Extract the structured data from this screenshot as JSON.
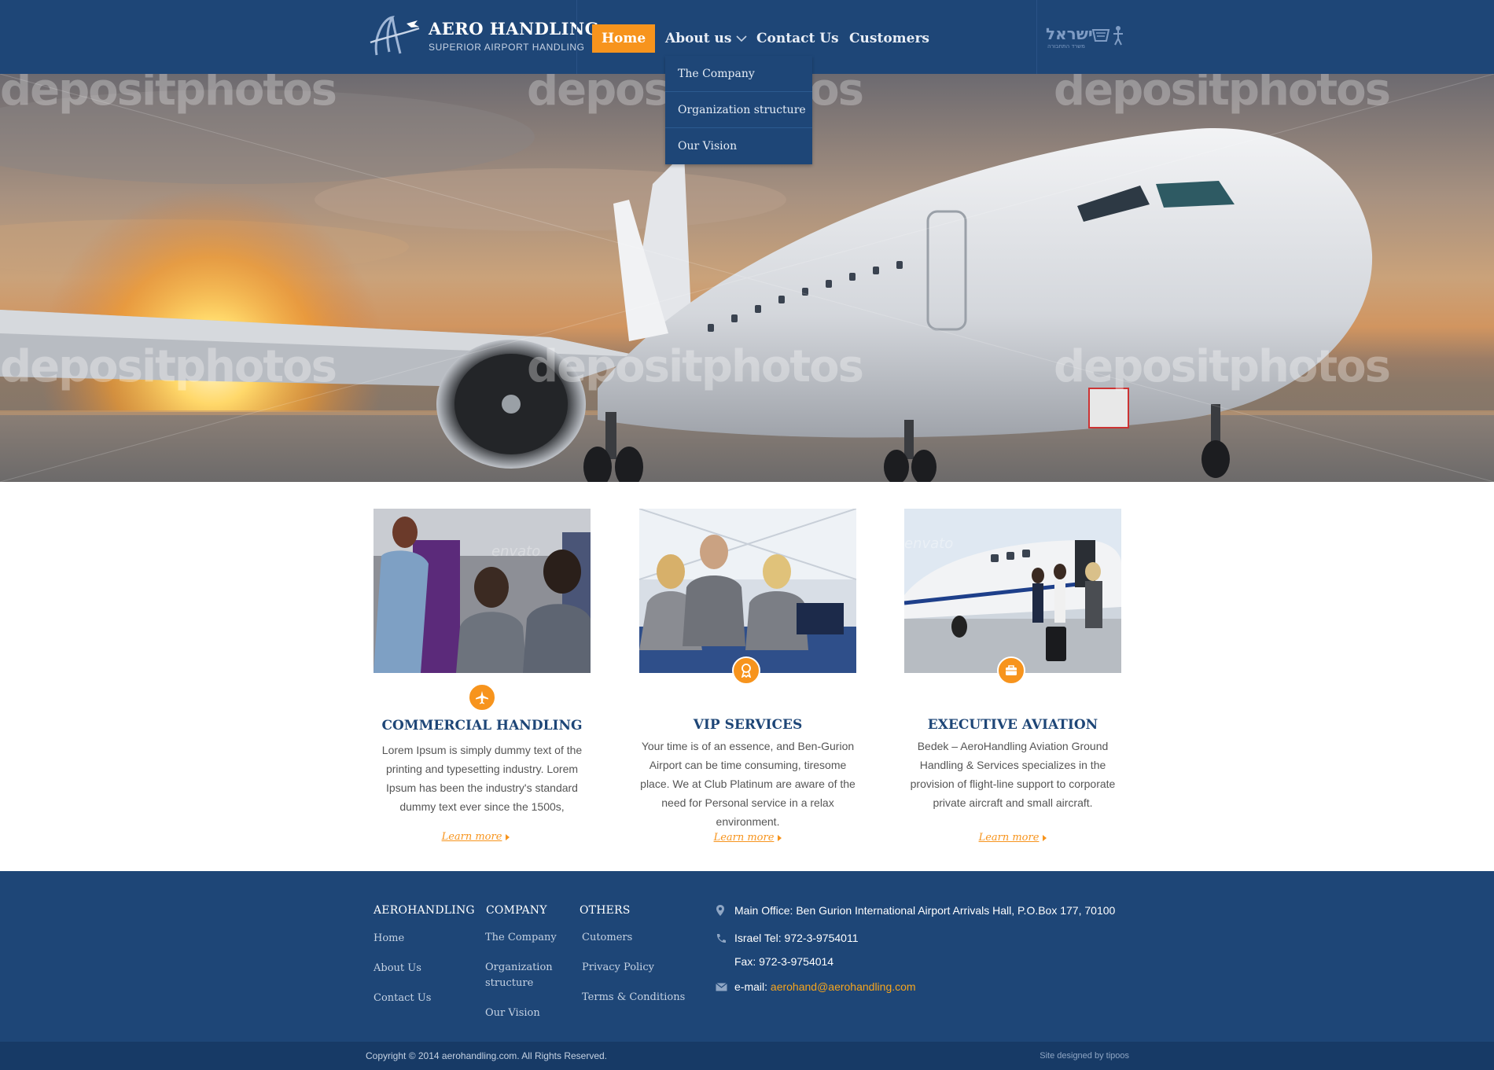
{
  "header": {
    "logo_name": "AERO HANDLING",
    "logo_tagline": "SUPERIOR AIRPORT HANDLING",
    "nav": [
      {
        "label": "Home",
        "active": true
      },
      {
        "label": "About us",
        "active": false
      },
      {
        "label": "Contact Us",
        "active": false
      },
      {
        "label": "Customers",
        "active": false
      }
    ],
    "about_dropdown": [
      "The Company",
      "Organization structure",
      "Our Vision"
    ],
    "gov_logo_text": "ישראל",
    "gov_logo_subtext": "משרד התחבורה"
  },
  "hero": {
    "watermark": "depositphotos"
  },
  "services": [
    {
      "icon": "airplane-icon",
      "title": "COMMERCIAL HANDLING",
      "text": "Lorem Ipsum is simply dummy text of the printing and typesetting industry. Lorem Ipsum has been the industry's standard dummy text ever since the 1500s,",
      "link": "Learn more",
      "image_watermark": "envato"
    },
    {
      "icon": "vip-ribbon-icon",
      "title": "VIP SERVICES",
      "text": "Your time is of an essence, and Ben-Gurion Airport can be time consuming, tiresome place. We at Club Platinum are aware of the need for Personal service in a relax environment.",
      "link": "Learn more",
      "image_watermark": ""
    },
    {
      "icon": "briefcase-icon",
      "title": "EXECUTIVE AVIATION",
      "text": "Bedek – AeroHandling Aviation Ground Handling & Services specializes in the provision of flight-line support to corporate private aircraft and small aircraft.",
      "link": "Learn more",
      "image_watermark": "envato"
    }
  ],
  "footer": {
    "columns": [
      {
        "title": "AEROHANDLING",
        "links": [
          "Home",
          "About Us",
          "Contact Us"
        ]
      },
      {
        "title": "COMPANY",
        "links": [
          "The Company",
          "Organization structure",
          "Our Vision"
        ]
      },
      {
        "title": "OTHERS",
        "links": [
          "Cutomers",
          "Privacy Policy",
          "Terms & Conditions"
        ]
      }
    ],
    "contact": {
      "address": "Main Office: Ben Gurion International Airport Arrivals Hall, P.O.Box 177, 70100",
      "tel": "Israel Tel: 972-3-9754011",
      "fax": "Fax: 972-3-9754014",
      "email_label": "e-mail: ",
      "email": "aerohand@aerohandling.com"
    },
    "copyright": "Copyright © 2014 aerohandling.com. All Rights Reserved.",
    "credit": "Site designed by tipoos"
  },
  "colors": {
    "primary_blue": "#1e4677",
    "accent_orange": "#f7941d",
    "link_orange": "#f7a51d"
  }
}
